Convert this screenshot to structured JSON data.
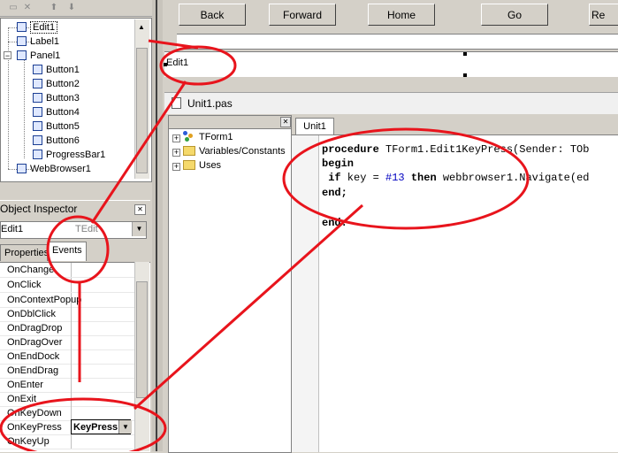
{
  "structure_tree": {
    "items": [
      {
        "label": "Edit1",
        "selected": true
      },
      {
        "label": "Label1"
      },
      {
        "label": "Panel1",
        "expanded": true
      },
      {
        "label": "Button1"
      },
      {
        "label": "Button2"
      },
      {
        "label": "Button3"
      },
      {
        "label": "Button4"
      },
      {
        "label": "Button5"
      },
      {
        "label": "Button6"
      },
      {
        "label": "ProgressBar1"
      },
      {
        "label": "WebBrowser1"
      }
    ]
  },
  "object_inspector": {
    "title": "Object Inspector",
    "selected_component": "Edit1",
    "selected_type": "TEdit",
    "tabs": [
      "Properties",
      "Events"
    ],
    "active_tab": "Events",
    "events": [
      {
        "name": "OnChange"
      },
      {
        "name": "OnClick"
      },
      {
        "name": "OnContextPopup"
      },
      {
        "name": "OnDblClick"
      },
      {
        "name": "OnDragDrop"
      },
      {
        "name": "OnDragOver"
      },
      {
        "name": "OnEndDock"
      },
      {
        "name": "OnEndDrag"
      },
      {
        "name": "OnEnter"
      },
      {
        "name": "OnExit"
      },
      {
        "name": "OnKeyDown"
      },
      {
        "name": "OnKeyPress",
        "value": "KeyPress"
      },
      {
        "name": "OnKeyUp"
      }
    ]
  },
  "form_designer": {
    "buttons": [
      "Back",
      "Forward",
      "Home",
      "Go",
      "Re"
    ],
    "edit_text": "Edit1"
  },
  "editor": {
    "title": "Unit1.pas",
    "tab": "Unit1",
    "code_explorer": [
      {
        "label": "TForm1",
        "icon": "class-icon"
      },
      {
        "label": "Variables/Constants",
        "icon": "folder-icon"
      },
      {
        "label": "Uses",
        "icon": "folder-icon"
      }
    ],
    "code": {
      "line1_kw": "procedure",
      "line1_rest": " TForm1.Edit1KeyPress(Sender: TOb",
      "line2_kw": "begin",
      "line3_kw1": " if",
      "line3_mid": " key = ",
      "line3_num": "#13",
      "line3_kw2": " then",
      "line3_rest": " webbrowser1.Navigate(ed",
      "line4_kw": "end;",
      "line5_kw": "end."
    }
  },
  "colors": {
    "annotation": "#e8141c",
    "panel_bg": "#d4d0c8",
    "number_literal": "#0000c0"
  }
}
